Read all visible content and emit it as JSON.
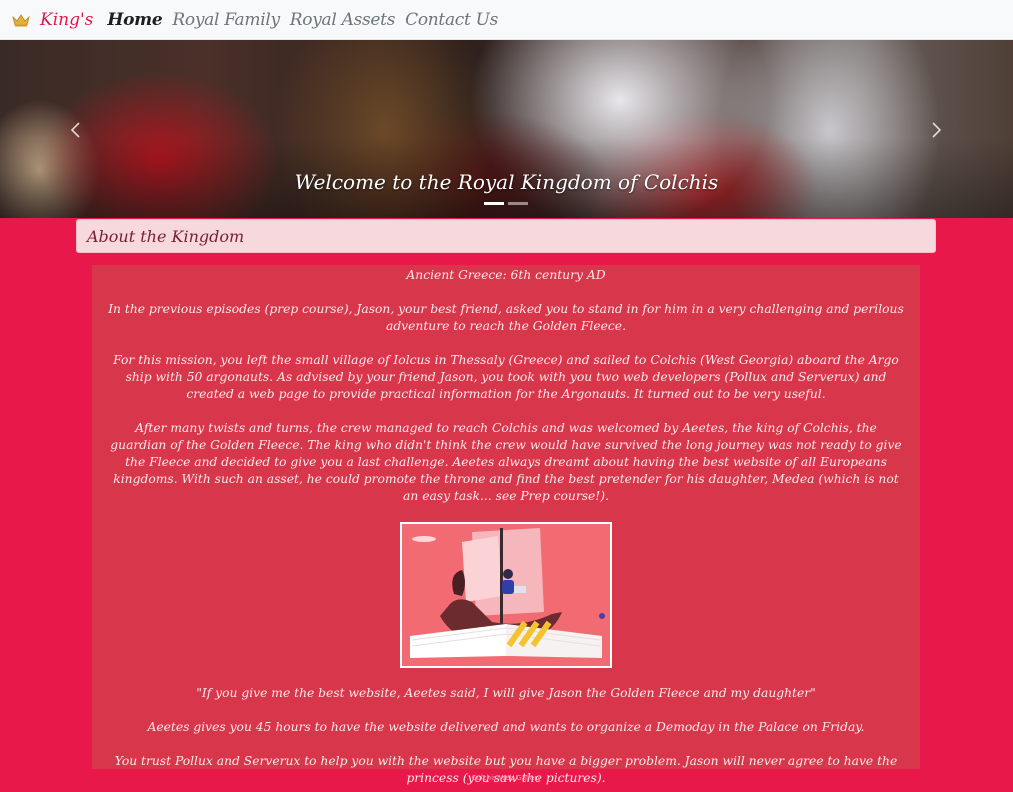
{
  "navbar": {
    "brand": "King's",
    "links": [
      {
        "label": "Home",
        "active": true
      },
      {
        "label": "Royal Family",
        "active": false
      },
      {
        "label": "Royal Assets",
        "active": false
      },
      {
        "label": "Contact Us",
        "active": false
      }
    ]
  },
  "carousel": {
    "caption": "Welcome to the Royal Kingdom of Colchis",
    "slide_count": 2,
    "active_slide": 1
  },
  "about": {
    "title": "About the Kingdom"
  },
  "content": {
    "paragraphs": [
      "Ancient Greece: 6th century AD",
      "In the previous episodes (prep course), Jason, your best friend, asked you to stand in for him in a very challenging and perilous adventure to reach the Golden Fleece.",
      "For this mission, you left the small village of Iolcus in Thessaly (Greece) and sailed to Colchis (West Georgia) aboard the Argo ship with 50 argonauts. As advised by your friend Jason, you took with you two web developers (Pollux and Serverux) and created a web page to provide practical information for the Argonauts. It turned out to be very useful.",
      "After many twists and turns, the crew managed to reach Colchis and was welcomed by Aeetes, the king of Colchis, the guardian of the Golden Fleece. The king who didn't think the crew would have survived the long journey was not ready to give the Fleece and decided to give you a last challenge. Aeetes always dreamt about having the best website of all Europeans kingdoms. With such an asset, he could promote the throne and find the best pretender for his daughter, Medea (which is not an easy task... see Prep course!)."
    ],
    "after_image": [
      "\"If you give me the best website, Aeetes said, I will give Jason the Golden Fleece and my daughter\"",
      "Aeetes gives you 45 hours to have the website delivered and wants to organize a Demoday in the Palace on Friday.",
      "You trust Pollux and Serverux to help you with the website but you have a bigger problem. Jason will never agree to have the princess (you saw the pictures)."
    ]
  },
  "footer": {
    "text": "Colchis Web Gallery"
  },
  "colors": {
    "page_bg": "#e8184a",
    "card_bg": "#d8364b",
    "brand": "#e0194c",
    "header_bg": "#f7d8dc"
  }
}
